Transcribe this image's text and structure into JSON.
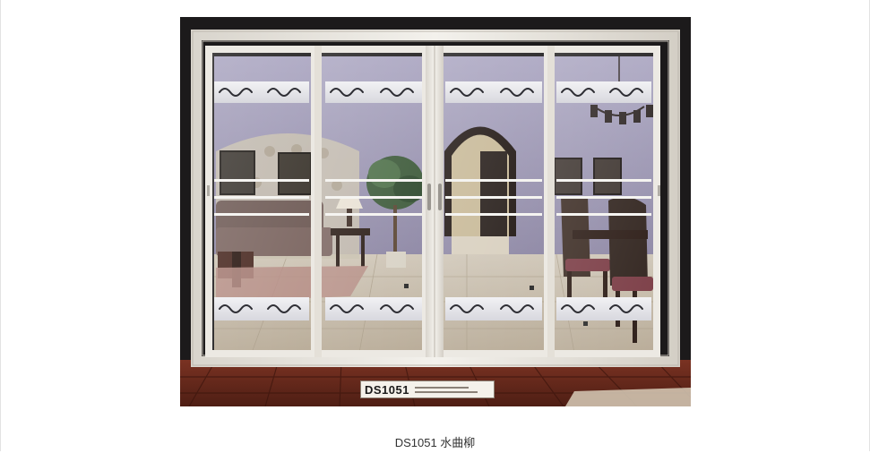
{
  "product": {
    "plate_code": "DS1051",
    "caption": "DS1051 水曲柳"
  },
  "colors": {
    "frame": "#e9e6df",
    "wall": "#8f88a6",
    "floor": "#6b2b1c",
    "background": "#141414"
  }
}
